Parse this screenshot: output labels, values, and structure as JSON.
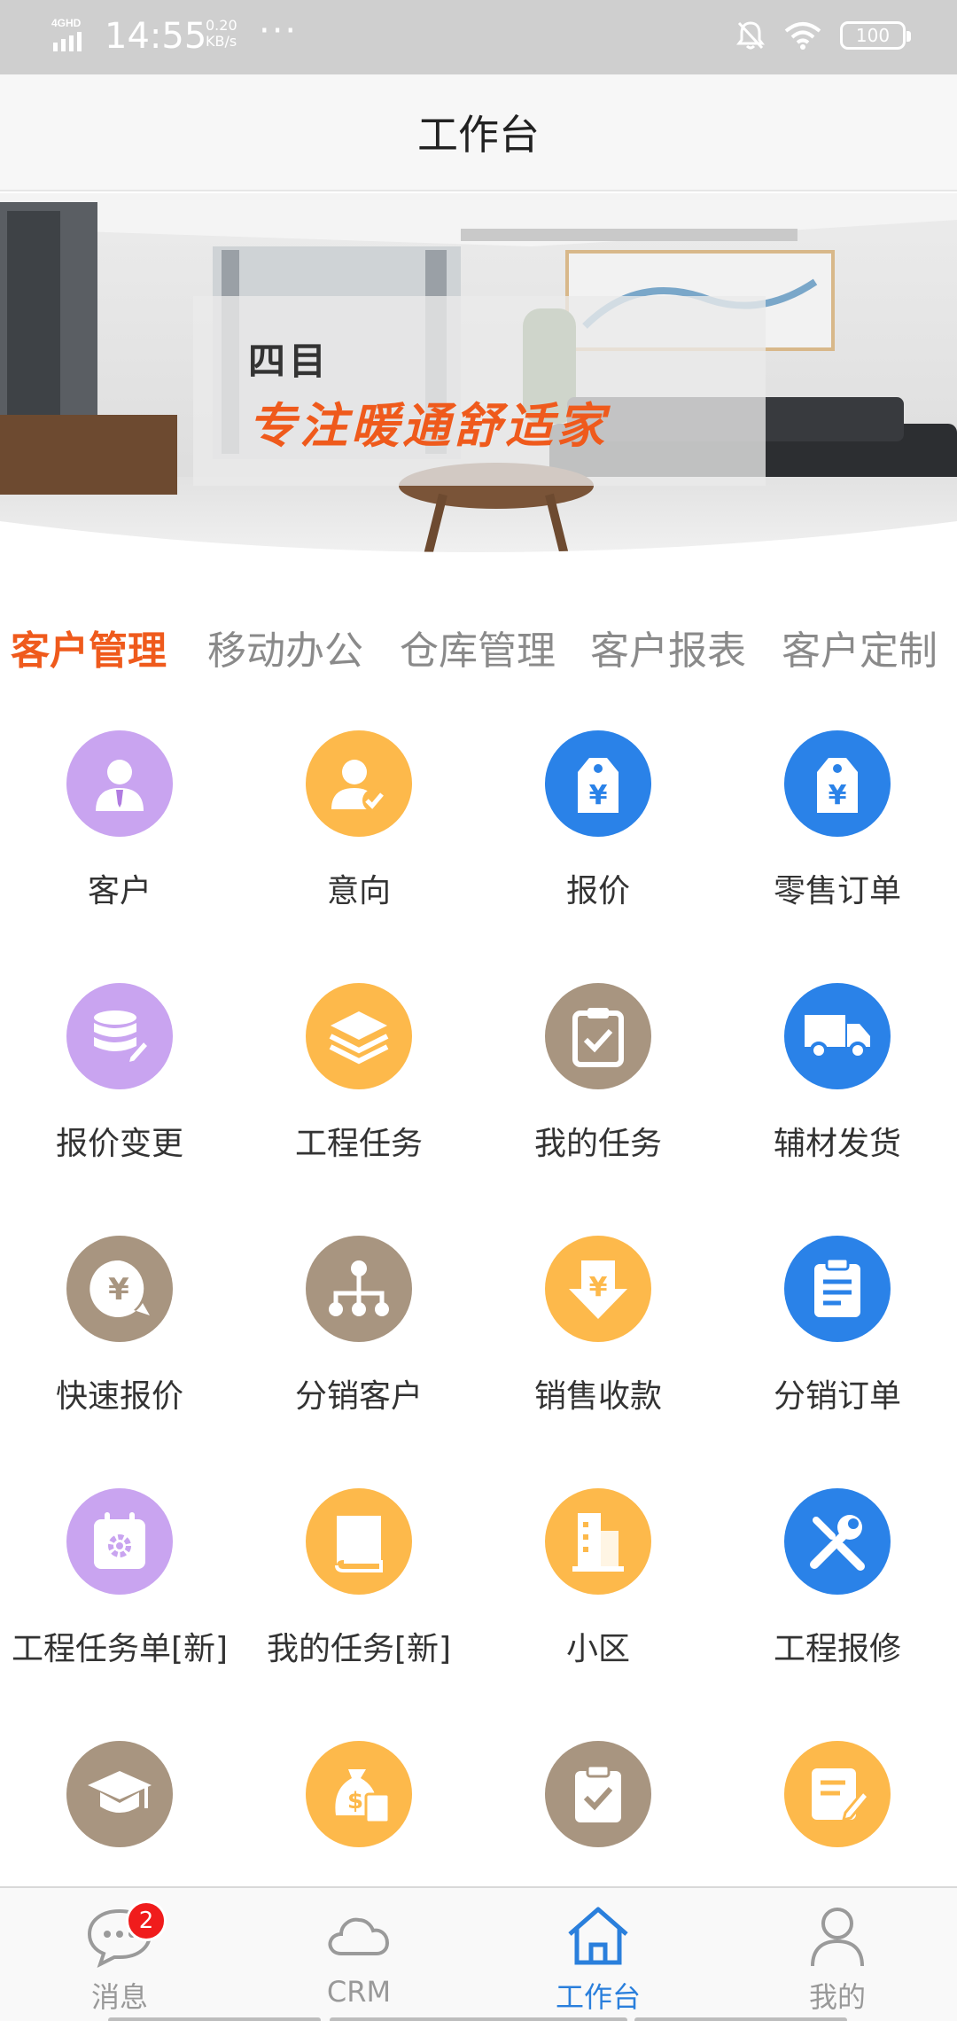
{
  "status_bar": {
    "network": "4GHD",
    "time": "14:55",
    "speed_value": "0.20",
    "speed_unit": "KB/s",
    "dots": "···",
    "battery": "100"
  },
  "header": {
    "title": "工作台"
  },
  "banner": {
    "brand": "四目",
    "slogan": "专注暖通舒适家"
  },
  "tabs": [
    {
      "label": "客户管理",
      "active": true
    },
    {
      "label": "移动办公",
      "active": false
    },
    {
      "label": "仓库管理",
      "active": false
    },
    {
      "label": "客户报表",
      "active": false
    },
    {
      "label": "客户定制",
      "active": false
    }
  ],
  "grid": [
    {
      "label": "客户",
      "icon": "person-icon",
      "color": "#c9a4f0"
    },
    {
      "label": "意向",
      "icon": "person-check-icon",
      "color": "#fdb94b"
    },
    {
      "label": "报价",
      "icon": "yen-tag-icon",
      "color": "#2a82e8"
    },
    {
      "label": "零售订单",
      "icon": "yen-tag-icon",
      "color": "#2a82e8"
    },
    {
      "label": "报价变更",
      "icon": "database-edit-icon",
      "color": "#c9a4f0"
    },
    {
      "label": "工程任务",
      "icon": "layers-icon",
      "color": "#fdb94b"
    },
    {
      "label": "我的任务",
      "icon": "clipboard-check-icon",
      "color": "#a89580"
    },
    {
      "label": "辅材发货",
      "icon": "truck-icon",
      "color": "#2a82e8"
    },
    {
      "label": "快速报价",
      "icon": "yen-bubble-icon",
      "color": "#a89580"
    },
    {
      "label": "分销客户",
      "icon": "hierarchy-icon",
      "color": "#a89580"
    },
    {
      "label": "销售收款",
      "icon": "yen-arrow-down-icon",
      "color": "#fdb94b"
    },
    {
      "label": "分销订单",
      "icon": "clipboard-list-icon",
      "color": "#2a82e8"
    },
    {
      "label": "工程任务单[新]",
      "icon": "calendar-gear-icon",
      "color": "#c9a4f0"
    },
    {
      "label": "我的任务[新]",
      "icon": "book-icon",
      "color": "#fdb94b"
    },
    {
      "label": "小区",
      "icon": "building-icon",
      "color": "#fdb94b"
    },
    {
      "label": "工程报修",
      "icon": "tools-icon",
      "color": "#2a82e8"
    },
    {
      "label": "",
      "icon": "graduation-cap-icon",
      "color": "#a89580"
    },
    {
      "label": "",
      "icon": "money-bag-icon",
      "color": "#fdb94b"
    },
    {
      "label": "",
      "icon": "clipboard-check-icon",
      "color": "#a89580"
    },
    {
      "label": "",
      "icon": "note-edit-icon",
      "color": "#fdb94b"
    }
  ],
  "bottom_nav": [
    {
      "label": "消息",
      "icon": "chat-icon",
      "badge": "2",
      "active": false
    },
    {
      "label": "CRM",
      "icon": "cloud-icon",
      "active": false
    },
    {
      "label": "工作台",
      "icon": "home-icon",
      "active": true
    },
    {
      "label": "我的",
      "icon": "user-icon",
      "active": false
    }
  ],
  "colors": {
    "accent": "#ef5a1c",
    "active_nav": "#2a7fdc",
    "badge": "#f01c1c"
  }
}
